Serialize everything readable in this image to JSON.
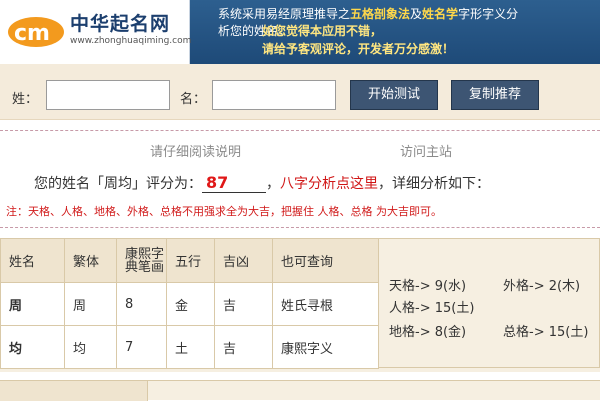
{
  "header": {
    "logo_title": "中华起名网",
    "logo_url": "www.zhonghuaqiming.com",
    "intro_prefix": "系统采用易经原理推导之",
    "intro_method1": "五格剖象法",
    "intro_and": "及",
    "intro_method2": "姓名学",
    "intro_suffix": "字形字义分",
    "intro_line2": "析您的姓名。",
    "notice_line1": "如您觉得本应用不错，",
    "notice_line2": "请给予客观评论，开发者万分感激！"
  },
  "form": {
    "surname_label": "姓：",
    "surname_value": "",
    "name_label": "名：",
    "name_value": "",
    "test_button": "开始测试",
    "copy_button": "复制推荐"
  },
  "result": {
    "instructions_link": "请仔细阅读说明",
    "home_link": "访问主站",
    "score_prefix": "您的姓名「周均」评分为：",
    "score_value": "87",
    "score_mid": "，",
    "bazi_link": "八字分析点这里",
    "score_suffix": "，详细分析如下：",
    "note": "注：天格、人格、地格、外格、总格不用强求全为大吉，把握住 人格、总格 为大吉即可。"
  },
  "table": {
    "headers": [
      "姓名",
      "繁体",
      "康熙字典笔画",
      "五行",
      "吉凶",
      "也可查询"
    ],
    "rows": [
      {
        "char": "周",
        "trad": "周",
        "strokes": "8",
        "element": "金",
        "luck": "吉",
        "query": "姓氏寻根"
      },
      {
        "char": "均",
        "trad": "均",
        "strokes": "7",
        "element": "土",
        "luck": "吉",
        "query": "康熙字义"
      }
    ],
    "grids": {
      "tian": "天格-> 9(水)",
      "ren": "人格-> 15(土)",
      "di": "地格-> 8(金)",
      "wai": "外格-> 2(木)",
      "zong": "总格-> 15(土)"
    }
  },
  "colors": {
    "banner": "#1e4a78",
    "score": "#e01818",
    "note": "#d11a1a",
    "query_link": "#8a1f6e"
  }
}
